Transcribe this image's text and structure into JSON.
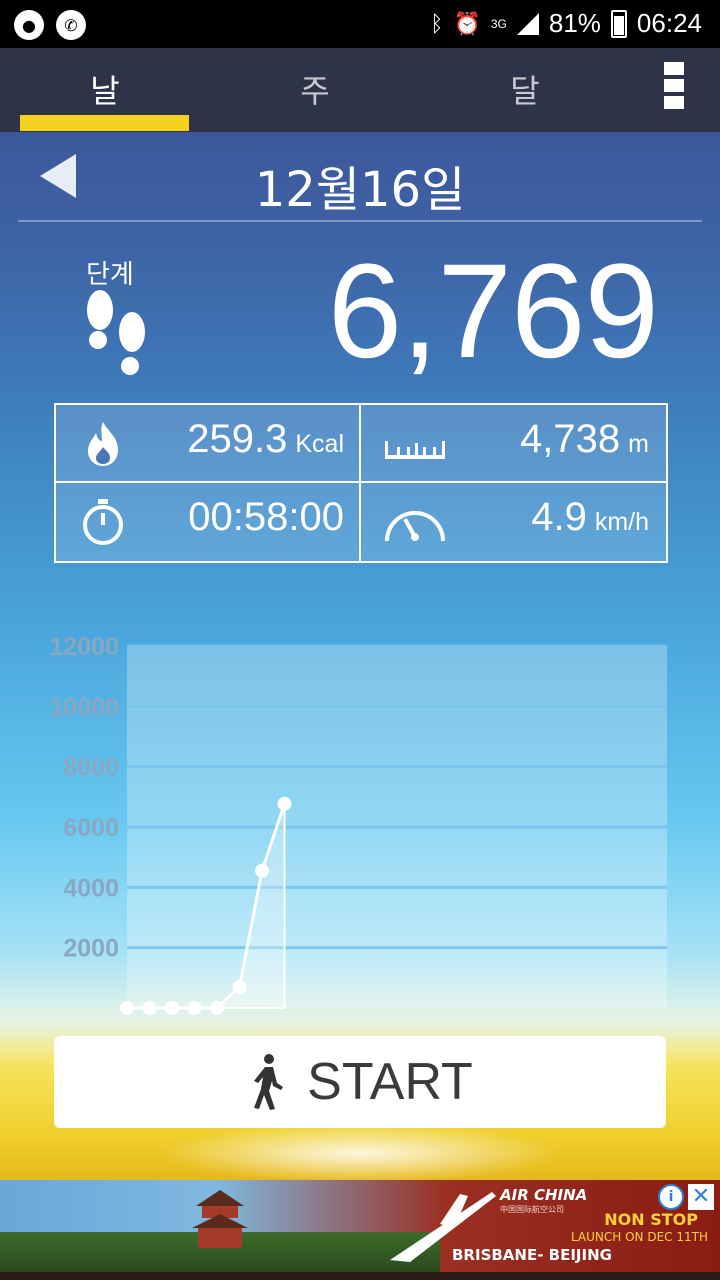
{
  "status_bar": {
    "battery": "81%",
    "time": "06:24",
    "network": "3G"
  },
  "tabs": [
    {
      "label": "날"
    },
    {
      "label": "주"
    },
    {
      "label": "달"
    }
  ],
  "date_title": "12월16일",
  "steps": {
    "label": "단계",
    "value": "6,769"
  },
  "stats": {
    "calories": {
      "value": "259.3",
      "unit": "Kcal"
    },
    "distance": {
      "value": "4,738",
      "unit": "m"
    },
    "duration": {
      "value": "00:58:00"
    },
    "speed": {
      "value": "4.9",
      "unit": "km/h"
    }
  },
  "chart_data": {
    "type": "area",
    "yticks": [
      "12000",
      "10000",
      "8000",
      "6000",
      "4000",
      "2000"
    ],
    "ylim": [
      0,
      12000
    ],
    "xlim": [
      0,
      24
    ],
    "xticks": [
      "2",
      "4",
      "6",
      "8",
      "10",
      "12",
      "14",
      "16",
      "18",
      "20",
      "22",
      "24"
    ],
    "x": [
      0,
      1,
      2,
      3,
      4,
      5,
      6,
      7
    ],
    "y": [
      0,
      0,
      0,
      0,
      0,
      700,
      4550,
      6769
    ],
    "grid": true
  },
  "start_button": {
    "label": "START"
  },
  "ad": {
    "brand": "AIR CHINA",
    "brand_sub": "中国国际航空公司",
    "line1": "NON STOP",
    "line2": "LAUNCH ON DEC 11TH",
    "route": "BRISBANE- BEIJING",
    "info": "i",
    "close": "✕"
  }
}
